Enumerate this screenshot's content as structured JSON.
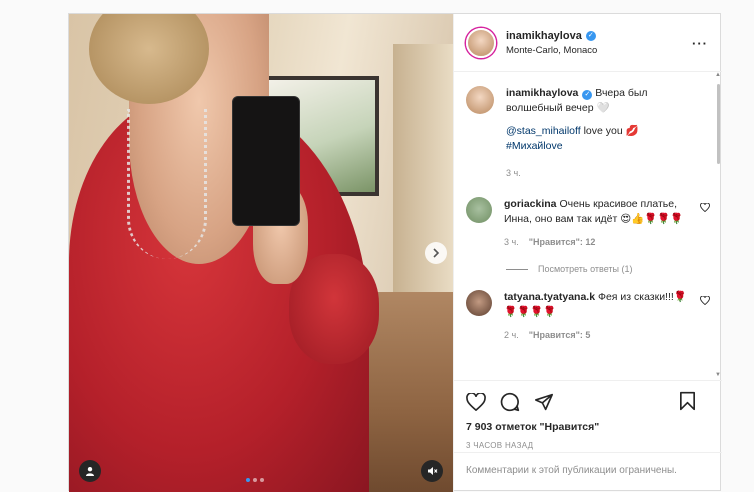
{
  "post": {
    "user": "inamikhaylova",
    "location": "Monte-Carlo, Monaco",
    "more_icon": "more-dots-icon",
    "caption": {
      "user": "inamikhaylova",
      "text": "Вчера был волшебный вечер 🤍",
      "mention": "@stas_mihailoff",
      "mention_text": " love you 💋",
      "hashtag": "#Михайlove",
      "time": "3 ч."
    },
    "comments": [
      {
        "user": "goriackina",
        "text": "Очень красивое платье, Инна, оно вам так идёт 😍👍🌹🌹🌹",
        "time": "3 ч.",
        "likes": "\"Нравится\": 12"
      },
      {
        "user": "tatyana.tyatyana.k",
        "text": "Фея из сказки!!!🌹🌹🌹🌹🌹",
        "time": "2 ч.",
        "likes": "\"Нравится\": 5"
      }
    ],
    "view_replies": "Посмотреть ответы (1)",
    "likes_count": "7 903 отметок \"Нравится\"",
    "posted": "3 ЧАСОВ НАЗАД",
    "comments_limited": "Комментарии к этой публикации ограничены.",
    "media_icons": {
      "next": "chevron-right-icon",
      "tag": "user-tag-icon",
      "mute": "sound-off-icon"
    },
    "carousel": {
      "count": 3,
      "active": 1
    },
    "colors": {
      "accent": "#3897f0",
      "link": "#00376b",
      "muted": "#8e8e8e"
    }
  }
}
